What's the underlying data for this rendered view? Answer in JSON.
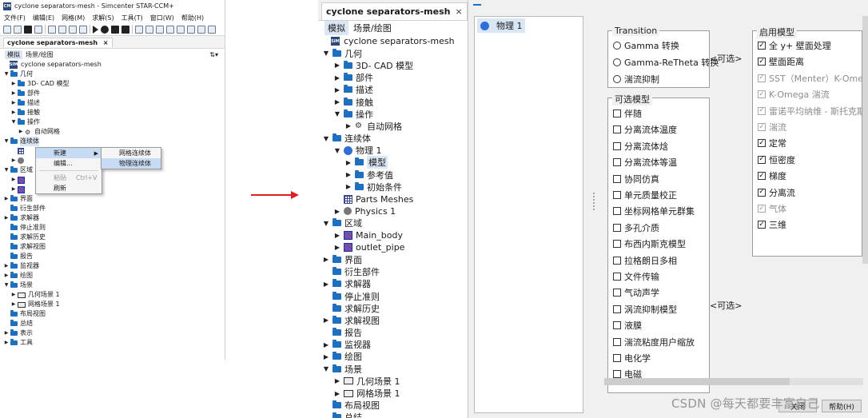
{
  "left_window": {
    "title": "cyclone separators-mesh - Simcenter STAR-CCM+",
    "app_logo": "CM",
    "menus": [
      "文件(F)",
      "编辑(E)",
      "网格(M)",
      "求解(S)",
      "工具(T)",
      "窗口(W)",
      "帮助(H)"
    ],
    "tab_title": "cyclone separators-mesh",
    "tab_close": "×",
    "subtabs": [
      "模拟",
      "场景/绘图"
    ],
    "tree": [
      {
        "label": "cyclone separators-mesh",
        "icon": "sim-root-icon",
        "arrow": ""
      },
      {
        "label": "几何",
        "icon": "folder-icon",
        "arrow": "▼"
      },
      {
        "label": "3D- CAD 模型",
        "icon": "folder-icon",
        "arrow": "▶"
      },
      {
        "label": "部件",
        "icon": "folder-icon",
        "arrow": "▶"
      },
      {
        "label": "描述",
        "icon": "folder-icon",
        "arrow": "▶"
      },
      {
        "label": "接触",
        "icon": "folder-icon",
        "arrow": "▶"
      },
      {
        "label": "操作",
        "icon": "folder-icon",
        "arrow": "▼"
      },
      {
        "label": "自动网格",
        "icon": "automesh-icon",
        "arrow": "▶"
      },
      {
        "label": "连续体",
        "icon": "folder-icon",
        "arrow": "▼"
      },
      {
        "label": "",
        "icon": "mesh-icon",
        "arrow": ""
      },
      {
        "label": "",
        "icon": "gray-dot-icon",
        "arrow": "▶"
      },
      {
        "label": "区域",
        "icon": "folder-icon",
        "arrow": "▼"
      },
      {
        "label": "",
        "icon": "region-icon",
        "arrow": "▶"
      },
      {
        "label": "",
        "icon": "region-icon",
        "arrow": "▶"
      },
      {
        "label": "界面",
        "icon": "folder-icon",
        "arrow": "▶"
      },
      {
        "label": "衍生部件",
        "icon": "folder-icon",
        "arrow": ""
      },
      {
        "label": "求解器",
        "icon": "folder-icon",
        "arrow": "▶"
      },
      {
        "label": "停止准则",
        "icon": "folder-icon",
        "arrow": ""
      },
      {
        "label": "求解历史",
        "icon": "folder-icon",
        "arrow": ""
      },
      {
        "label": "求解视图",
        "icon": "folder-icon",
        "arrow": ""
      },
      {
        "label": "报告",
        "icon": "folder-icon",
        "arrow": ""
      },
      {
        "label": "监视器",
        "icon": "folder-icon",
        "arrow": "▶"
      },
      {
        "label": "绘图",
        "icon": "folder-icon",
        "arrow": "▶"
      },
      {
        "label": "场景",
        "icon": "folder-icon",
        "arrow": "▼"
      },
      {
        "label": "几何场景 1",
        "icon": "scene-icon",
        "arrow": "▶"
      },
      {
        "label": "网格场景 1",
        "icon": "scene-icon",
        "arrow": "▶"
      },
      {
        "label": "布局视图",
        "icon": "folder-icon",
        "arrow": ""
      },
      {
        "label": "总结",
        "icon": "folder-icon",
        "arrow": ""
      },
      {
        "label": "表示",
        "icon": "folder-icon",
        "arrow": "▶"
      },
      {
        "label": "工具",
        "icon": "folder-icon",
        "arrow": "▶"
      }
    ],
    "context_menu": {
      "new": "新建",
      "edit": "编辑...",
      "paste": "粘贴",
      "paste_shortcut": "Ctrl+V",
      "refresh": "刷新"
    },
    "submenu": {
      "mesh_continuum": "网格连续体",
      "physics_continuum": "物理连续体"
    }
  },
  "big_tree": {
    "tab_title": "cyclone separators-mesh",
    "tab_close": "×",
    "subtabs": [
      "模拟",
      "场景/绘图"
    ],
    "rows": [
      {
        "label": "cyclone separators-mesh",
        "icon": "sim-root-icon",
        "arrow": "",
        "indent": 0
      },
      {
        "label": "几何",
        "icon": "folder-icon",
        "arrow": "▼",
        "indent": 0
      },
      {
        "label": "3D- CAD 模型",
        "icon": "folder-icon",
        "arrow": "▶",
        "indent": 1
      },
      {
        "label": "部件",
        "icon": "folder-icon",
        "arrow": "▶",
        "indent": 1
      },
      {
        "label": "描述",
        "icon": "folder-icon",
        "arrow": "▶",
        "indent": 1
      },
      {
        "label": "接触",
        "icon": "folder-icon",
        "arrow": "▶",
        "indent": 1
      },
      {
        "label": "操作",
        "icon": "folder-icon",
        "arrow": "▼",
        "indent": 1
      },
      {
        "label": "自动网格",
        "icon": "automesh-icon",
        "arrow": "▶",
        "indent": 2
      },
      {
        "label": "连续体",
        "icon": "folder-icon",
        "arrow": "▼",
        "indent": 0
      },
      {
        "label": "物理 1",
        "icon": "globe-icon",
        "arrow": "▼",
        "indent": 1
      },
      {
        "label": "模型",
        "icon": "folder-icon",
        "arrow": "▶",
        "indent": 2,
        "selected": true
      },
      {
        "label": "参考值",
        "icon": "folder-icon",
        "arrow": "▶",
        "indent": 2
      },
      {
        "label": "初始条件",
        "icon": "folder-icon",
        "arrow": "▶",
        "indent": 2
      },
      {
        "label": "Parts Meshes",
        "icon": "mesh-icon",
        "arrow": "",
        "indent": 1
      },
      {
        "label": "Physics 1",
        "icon": "gray-dot-icon",
        "arrow": "▶",
        "indent": 1
      },
      {
        "label": "区域",
        "icon": "folder-icon",
        "arrow": "▼",
        "indent": 0
      },
      {
        "label": "Main_body",
        "icon": "region-icon",
        "arrow": "▶",
        "indent": 1
      },
      {
        "label": "outlet_pipe",
        "icon": "region-icon",
        "arrow": "▶",
        "indent": 1
      },
      {
        "label": "界面",
        "icon": "folder-icon",
        "arrow": "▶",
        "indent": 0
      },
      {
        "label": "衍生部件",
        "icon": "folder-icon",
        "arrow": "",
        "indent": 0
      },
      {
        "label": "求解器",
        "icon": "folder-icon",
        "arrow": "▶",
        "indent": 0
      },
      {
        "label": "停止准则",
        "icon": "folder-icon",
        "arrow": "",
        "indent": 0
      },
      {
        "label": "求解历史",
        "icon": "folder-icon",
        "arrow": "",
        "indent": 0
      },
      {
        "label": "求解视图",
        "icon": "folder-icon",
        "arrow": "▶",
        "indent": 0
      },
      {
        "label": "报告",
        "icon": "folder-icon",
        "arrow": "",
        "indent": 0
      },
      {
        "label": "监视器",
        "icon": "folder-icon",
        "arrow": "▶",
        "indent": 0
      },
      {
        "label": "绘图",
        "icon": "folder-icon",
        "arrow": "▶",
        "indent": 0
      },
      {
        "label": "场景",
        "icon": "folder-icon",
        "arrow": "▼",
        "indent": 0
      },
      {
        "label": "几何场景 1",
        "icon": "scene-icon",
        "arrow": "▶",
        "indent": 1
      },
      {
        "label": "网格场景 1",
        "icon": "scene-icon",
        "arrow": "▶",
        "indent": 1
      },
      {
        "label": "布局视图",
        "icon": "folder-icon",
        "arrow": "",
        "indent": 0
      },
      {
        "label": "总结",
        "icon": "folder-icon",
        "arrow": "",
        "indent": 0
      }
    ]
  },
  "model_panel": {
    "physics_list_item": "物理 1",
    "transition": {
      "title": "Transition",
      "options": [
        "Gamma 转换",
        "Gamma-ReTheta 转换",
        "湍流抑制"
      ],
      "optional": "<可选>"
    },
    "optional_models": {
      "title": "可选模型",
      "items": [
        "伴随",
        "分离流体温度",
        "分离流体焓",
        "分离流体等温",
        "协同仿真",
        "单元质量校正",
        "坐标网格单元群集",
        "多孔介质",
        "布西内斯克模型",
        "拉格朗日多相",
        "文件传输",
        "气动声学",
        "涡流抑制模型",
        "液膜",
        "湍流粘度用户缩放",
        "电化学",
        "电磁"
      ],
      "optional": "<可选>"
    },
    "enabled_models": {
      "title": "启用模型",
      "items": [
        {
          "label": "全 y+ 壁面处理",
          "checked": true,
          "dim": false
        },
        {
          "label": "壁面距离",
          "checked": true,
          "dim": false
        },
        {
          "label": "SST（Menter）K-Omega",
          "checked": true,
          "dim": true
        },
        {
          "label": "K-Omega 湍流",
          "checked": true,
          "dim": true
        },
        {
          "label": "雷诺平均纳维 - 斯托克斯",
          "checked": true,
          "dim": true
        },
        {
          "label": "湍流",
          "checked": true,
          "dim": true
        },
        {
          "label": "定常",
          "checked": true,
          "dim": false
        },
        {
          "label": "恒密度",
          "checked": true,
          "dim": false
        },
        {
          "label": "梯度",
          "checked": true,
          "dim": false
        },
        {
          "label": "分离流",
          "checked": true,
          "dim": false
        },
        {
          "label": "气体",
          "checked": true,
          "dim": true
        },
        {
          "label": "三维",
          "checked": true,
          "dim": false
        }
      ]
    },
    "buttons": {
      "close": "关闭",
      "help": "帮助(H)"
    },
    "watermark": "CSDN @每天都要丰富自己"
  },
  "colors": {
    "accent_blue": "#1f6fbf",
    "selection": "#dbe6f4",
    "menu_highlight": "#c7dcf4",
    "arrow_red": "#e02020"
  }
}
